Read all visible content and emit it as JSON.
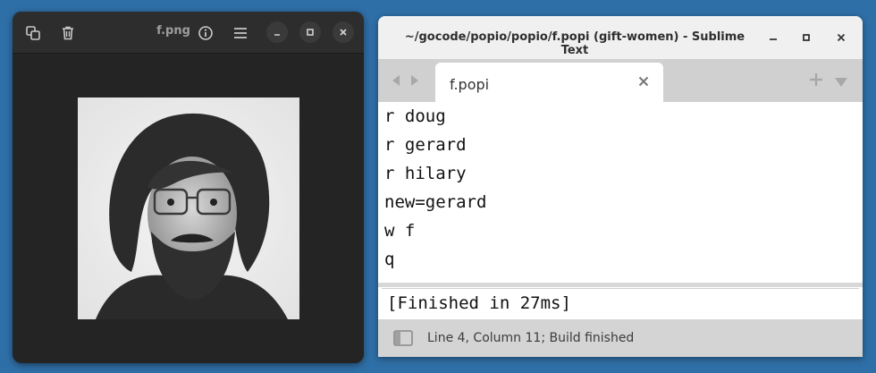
{
  "image_viewer": {
    "title": "f.png",
    "icons": [
      "copy-icon",
      "trash-icon",
      "info-icon",
      "menu-icon",
      "minimize-icon",
      "maximize-icon",
      "close-icon"
    ],
    "image_description_name": "photo-bearded-man-glasses"
  },
  "sublime": {
    "window_title": "~/gocode/popio/popio/f.popi (gift-women) - Sublime Text",
    "tab_label": "f.popi",
    "code_lines": [
      "r doug",
      "r gerard",
      "r hilary",
      "new=gerard",
      "w f",
      "q"
    ],
    "output": "[Finished in 27ms]",
    "status": "Line 4, Column 11; Build finished"
  },
  "colors": {
    "desktop": "#2f6fa7",
    "viewer_bg": "#242424",
    "sublime_tabbar": "#d0d0d0"
  }
}
